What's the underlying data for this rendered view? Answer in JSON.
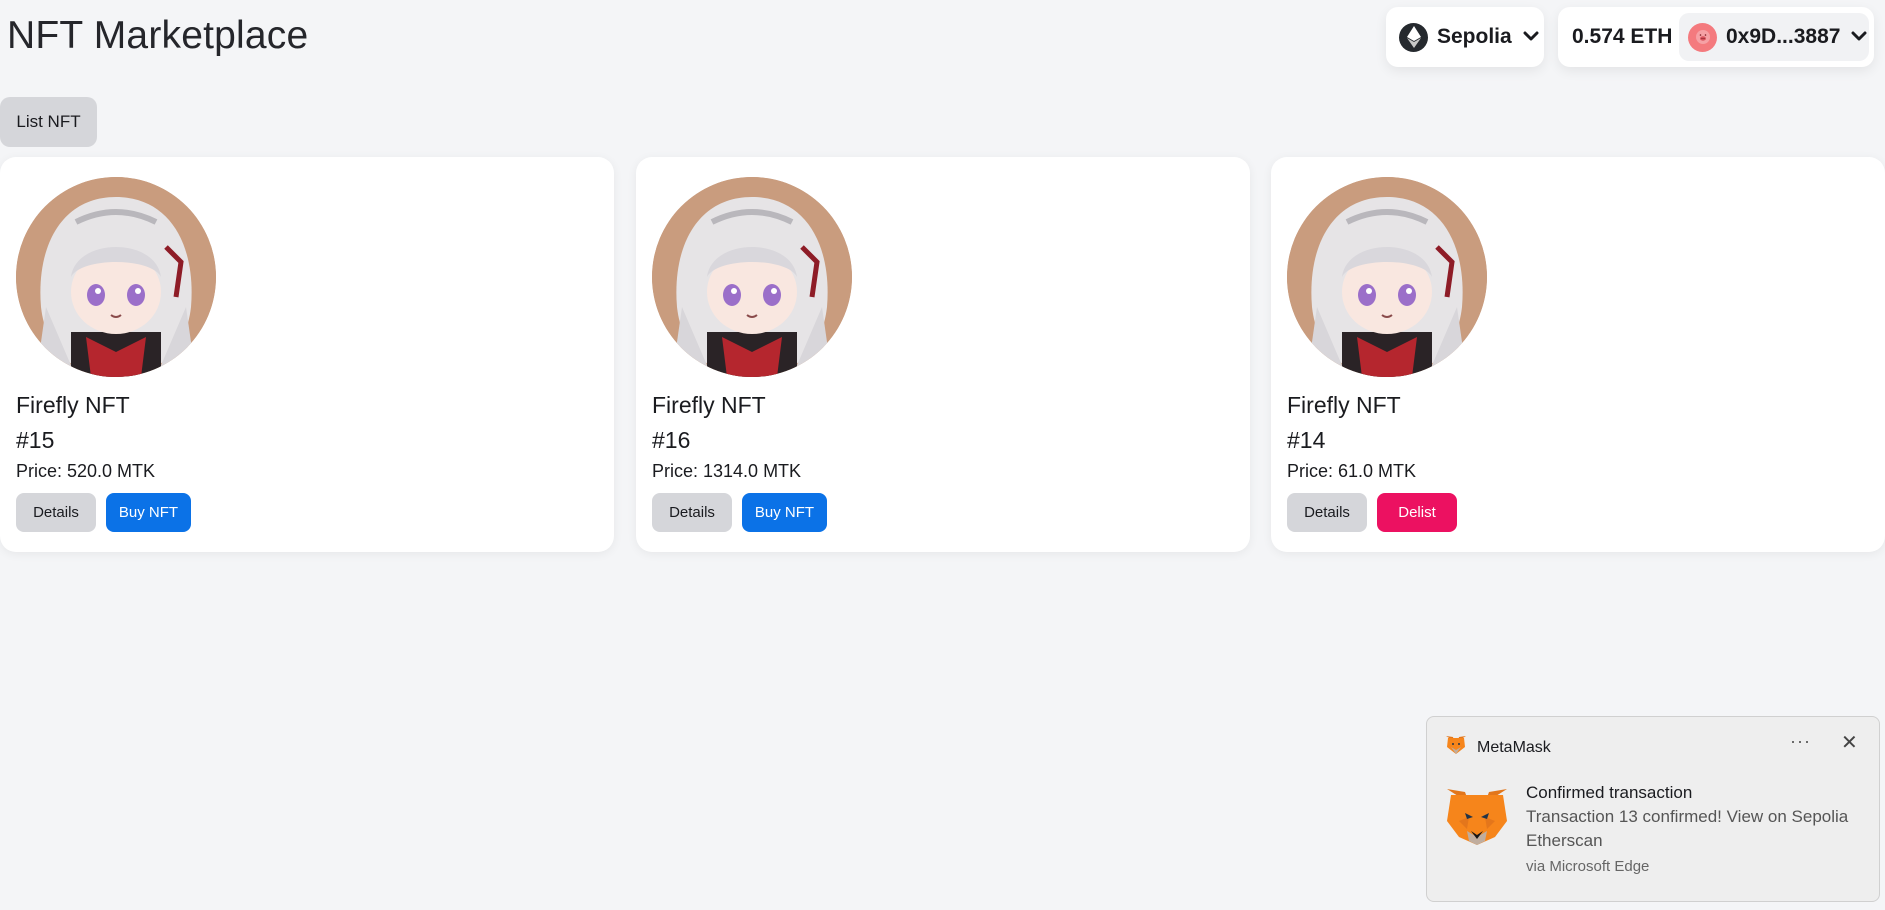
{
  "header": {
    "title": "NFT Marketplace",
    "network": "Sepolia",
    "balance": "0.574 ETH",
    "account": "0x9D...3887"
  },
  "actions": {
    "list_label": "List NFT"
  },
  "cards": [
    {
      "name": "Firefly NFT",
      "id": "#15",
      "price": "Price: 520.0 MTK",
      "details_label": "Details",
      "action_label": "Buy NFT",
      "action_type": "buy"
    },
    {
      "name": "Firefly NFT",
      "id": "#16",
      "price": "Price: 1314.0 MTK",
      "details_label": "Details",
      "action_label": "Buy NFT",
      "action_type": "buy"
    },
    {
      "name": "Firefly NFT",
      "id": "#14",
      "price": "Price: 61.0 MTK",
      "details_label": "Details",
      "action_label": "Delist",
      "action_type": "delist"
    }
  ],
  "toast": {
    "app": "MetaMask",
    "title": "Confirmed transaction",
    "body": "Transaction 13 confirmed! View on Sepolia Etherscan",
    "via": "via Microsoft Edge",
    "more_icon": "···",
    "close_icon": "✕"
  },
  "colors": {
    "buy": "#0b72e7",
    "delist": "#ec1161",
    "neutral_button": "#d5d6da",
    "background": "#f4f5f7"
  }
}
